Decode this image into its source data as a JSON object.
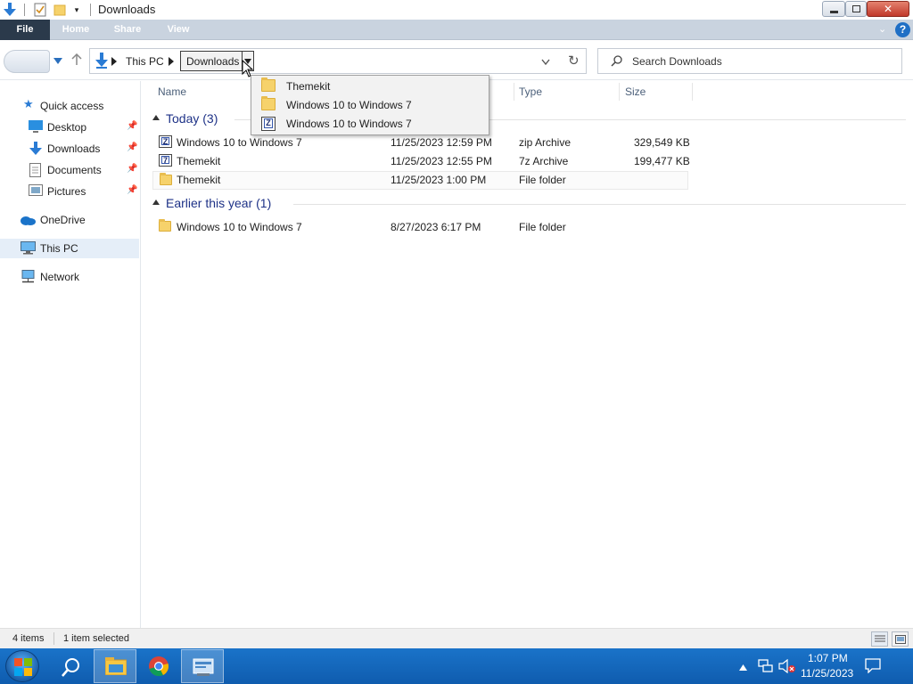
{
  "window": {
    "title": "Downloads"
  },
  "ribbon": {
    "tabs": [
      "File",
      "Home",
      "Share",
      "View"
    ],
    "help": "?"
  },
  "address": {
    "crumbs": [
      "This PC",
      "Downloads"
    ],
    "refresh_icon": "↻",
    "search_placeholder": "Search Downloads"
  },
  "dropdown": {
    "items": [
      {
        "label": "Themekit",
        "icon": "folder-icon"
      },
      {
        "label": "Windows 10 to Windows 7",
        "icon": "folder-icon"
      },
      {
        "label": "Windows 10 to Windows 7",
        "icon": "zip-icon"
      }
    ]
  },
  "sidebar": {
    "items": [
      {
        "label": "Quick access",
        "icon": "star-icon"
      },
      {
        "label": "Desktop",
        "icon": "desktop-icon",
        "pinned": true
      },
      {
        "label": "Downloads",
        "icon": "download-icon",
        "pinned": true
      },
      {
        "label": "Documents",
        "icon": "documents-icon",
        "pinned": true
      },
      {
        "label": "Pictures",
        "icon": "pictures-icon",
        "pinned": true
      },
      {
        "label": "OneDrive",
        "icon": "cloud-icon"
      },
      {
        "label": "This PC",
        "icon": "computer-icon",
        "selected": true
      },
      {
        "label": "Network",
        "icon": "network-icon"
      }
    ]
  },
  "columns": [
    "Name",
    "Type",
    "Size"
  ],
  "groups": [
    {
      "title": "Today (3)",
      "rows": [
        {
          "name": "Windows 10 to Windows 7",
          "date": "11/25/2023 12:59 PM",
          "type": "zip Archive",
          "size": "329,549 KB",
          "icon": "zip-icon"
        },
        {
          "name": "Themekit",
          "date": "11/25/2023 12:55 PM",
          "type": "7z Archive",
          "size": "199,477 KB",
          "icon": "7z-icon"
        },
        {
          "name": "Themekit",
          "date": "11/25/2023 1:00 PM",
          "type": "File folder",
          "size": "",
          "icon": "folder-icon",
          "selected": true
        }
      ]
    },
    {
      "title": "Earlier this year (1)",
      "rows": [
        {
          "name": "Windows 10 to Windows 7",
          "date": "8/27/2023 6:17 PM",
          "type": "File folder",
          "size": "",
          "icon": "folder-icon"
        }
      ]
    }
  ],
  "status": {
    "item_count": "4 items",
    "selection": "1 item selected"
  },
  "taskbar": {
    "time": "1:07 PM",
    "date": "11/25/2023"
  }
}
